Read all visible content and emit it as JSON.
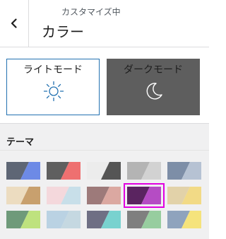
{
  "header": {
    "back_icon": "chevron-left-icon",
    "crumb": "カスタマイズ中",
    "title": "カラー"
  },
  "modes": {
    "light_label": "ライトモード",
    "light_icon": "sun-icon",
    "dark_label": "ダークモード",
    "dark_icon": "moon-icon"
  },
  "theme": {
    "section_title": "テーマ",
    "selected_index": 8,
    "swatches": [
      {
        "a": "#5e6675",
        "b": "#6d8ae6"
      },
      {
        "a": "#5f5f5f",
        "b": "#ee7070"
      },
      {
        "a": "#ececec",
        "b": "#555555"
      },
      {
        "a": "#b4b4b4",
        "b": "#d2d2d2"
      },
      {
        "a": "#7d8ea7",
        "b": "#b6c2d3"
      },
      {
        "a": "#ecdcc0",
        "b": "#c8a06e"
      },
      {
        "a": "#f4d8dc",
        "b": "#c8dfe9"
      },
      {
        "a": "#9d7a7a",
        "b": "#dba8a1"
      },
      {
        "a": "#5a2460",
        "b": "#b54cc4"
      },
      {
        "a": "#e2d2a9",
        "b": "#f2da86"
      },
      {
        "a": "#6f9a7a",
        "b": "#bee27e"
      },
      {
        "a": "#bad2e3",
        "b": "#c5d8e1"
      },
      {
        "a": "#6f6f84",
        "b": "#79d2cf"
      },
      {
        "a": "#7f7f7f",
        "b": "#97cd9f"
      },
      {
        "a": "#8fa3bd",
        "b": "#f5e37c"
      }
    ]
  }
}
